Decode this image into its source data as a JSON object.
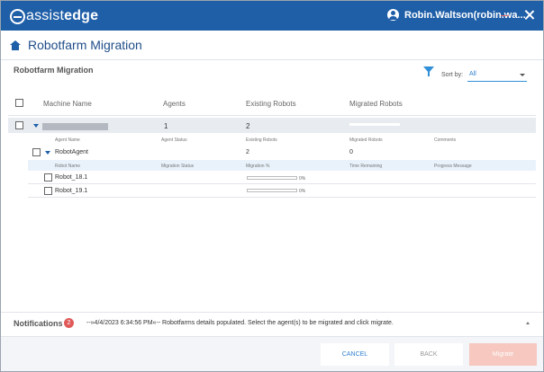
{
  "titlebar": {
    "logo_prefix": "assist",
    "logo_suffix": "edge",
    "user_name": "Robin.Waltson(robin.wa..."
  },
  "header": {
    "title": "Robotfarm Migration"
  },
  "panel": {
    "title": "Robotfarm Migration",
    "sort_label": "Sort by:",
    "sort_value": "All"
  },
  "table": {
    "headers": {
      "machine": "Machine Name",
      "agents": "Agents",
      "existing": "Existing Robots",
      "migrated": "Migrated Robots"
    },
    "machine_row": {
      "agents": "1",
      "existing": "2"
    },
    "agent_headers": {
      "name": "Agent Name",
      "status": "Agent Status",
      "existing": "Existing Robots",
      "migrated": "Migrated Robots",
      "comments": "Comments"
    },
    "agent_row": {
      "name": "RobotAgent",
      "existing": "2",
      "migrated": "0"
    },
    "robot_headers": {
      "name": "Robot Name",
      "status": "Migration Status",
      "percent": "Migration %",
      "remaining": "Time Remaining",
      "message": "Progress Message"
    },
    "robots": [
      {
        "name": "Robot_18.1",
        "percent_label": "0%",
        "progress": 0
      },
      {
        "name": "Robot_19.1",
        "percent_label": "0%",
        "progress": 0
      }
    ]
  },
  "notifications": {
    "label": "Notifications",
    "count": "2",
    "message": "--»4/4/2023 6:34:56 PM«-- Robotfarms details populated. Select the agent(s) to be migrated and click migrate."
  },
  "footer": {
    "cancel": "CANCEL",
    "back": "BACK",
    "migrate": "Migrate"
  },
  "colors": {
    "brand": "#1f5fa8",
    "accent": "#2f8fd8",
    "badge": "#e05a5a",
    "migrate_disabled": "#f6c8c0"
  },
  "icons": [
    "assistedge-logo-icon",
    "user-icon",
    "minimize-icon",
    "close-icon",
    "home-icon",
    "filter-icon",
    "chevron-down-icon",
    "caret-down-icon",
    "caret-up-icon"
  ]
}
